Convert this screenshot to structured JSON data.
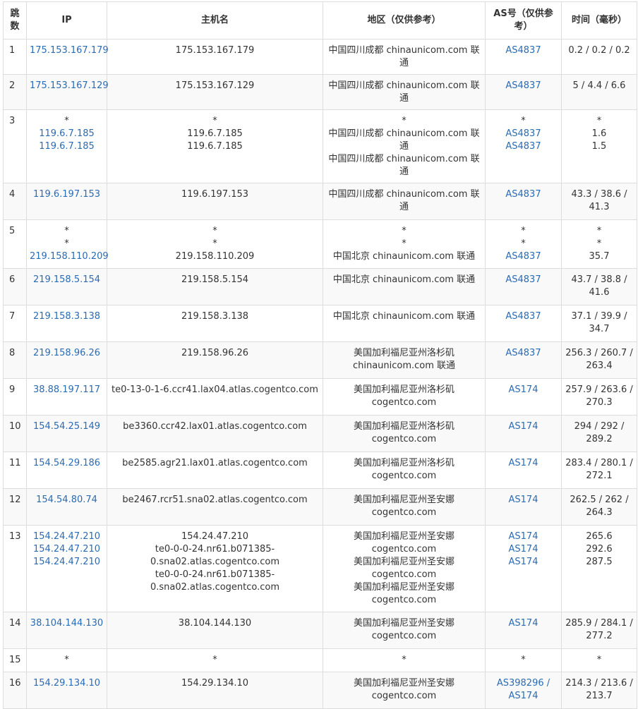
{
  "headers": {
    "hop": "跳数",
    "ip": "IP",
    "hostname": "主机名",
    "region": "地区（仅供参考）",
    "asn": "AS号（仅供参考）",
    "time": "时间（毫秒）"
  },
  "rows": [
    {
      "hop": "1",
      "ip": [
        "175.153.167.179"
      ],
      "host": [
        "175.153.167.179"
      ],
      "region": [
        "中国四川成都 chinaunicom.com 联通"
      ],
      "as": [
        "AS4837"
      ],
      "time": [
        "0.2 / 0.2 / 0.2"
      ]
    },
    {
      "hop": "2",
      "ip": [
        "175.153.167.129"
      ],
      "host": [
        "175.153.167.129"
      ],
      "region": [
        "中国四川成都 chinaunicom.com 联通"
      ],
      "as": [
        "AS4837"
      ],
      "time": [
        "5 / 4.4 / 6.6"
      ]
    },
    {
      "hop": "3",
      "ip": [
        "*",
        "119.6.7.185",
        "119.6.7.185"
      ],
      "host": [
        "*",
        "119.6.7.185",
        "119.6.7.185"
      ],
      "region": [
        "*",
        "中国四川成都 chinaunicom.com 联通",
        "中国四川成都 chinaunicom.com 联通"
      ],
      "as": [
        "*",
        "AS4837",
        "AS4837"
      ],
      "time": [
        "*",
        "1.6",
        "1.5"
      ]
    },
    {
      "hop": "4",
      "ip": [
        "119.6.197.153"
      ],
      "host": [
        "119.6.197.153"
      ],
      "region": [
        "中国四川成都 chinaunicom.com 联通"
      ],
      "as": [
        "AS4837"
      ],
      "time": [
        "43.3 / 38.6 /",
        "41.3"
      ]
    },
    {
      "hop": "5",
      "ip": [
        "*",
        "*",
        "219.158.110.209"
      ],
      "host": [
        "*",
        "*",
        "219.158.110.209"
      ],
      "region": [
        "*",
        "*",
        "中国北京 chinaunicom.com 联通"
      ],
      "as": [
        "*",
        "*",
        "AS4837"
      ],
      "time": [
        "*",
        "*",
        "35.7"
      ]
    },
    {
      "hop": "6",
      "ip": [
        "219.158.5.154"
      ],
      "host": [
        "219.158.5.154"
      ],
      "region": [
        "中国北京 chinaunicom.com 联通"
      ],
      "as": [
        "AS4837"
      ],
      "time": [
        "43.7 / 38.8 /",
        "41.6"
      ]
    },
    {
      "hop": "7",
      "ip": [
        "219.158.3.138"
      ],
      "host": [
        "219.158.3.138"
      ],
      "region": [
        "中国北京 chinaunicom.com 联通"
      ],
      "as": [
        "AS4837"
      ],
      "time": [
        "37.1 / 39.9 /",
        "34.7"
      ]
    },
    {
      "hop": "8",
      "ip": [
        "219.158.96.26"
      ],
      "host": [
        "219.158.96.26"
      ],
      "region": [
        "美国加利福尼亚州洛杉矶",
        "chinaunicom.com 联通"
      ],
      "as": [
        "AS4837"
      ],
      "time": [
        "256.3 / 260.7 /",
        "263.4"
      ]
    },
    {
      "hop": "9",
      "ip": [
        "38.88.197.117"
      ],
      "host": [
        "te0-13-0-1-6.ccr41.lax04.atlas.cogentco.com"
      ],
      "region": [
        "美国加利福尼亚州洛杉矶",
        "cogentco.com"
      ],
      "as": [
        "AS174"
      ],
      "time": [
        "257.9 / 263.6 /",
        "270.3"
      ]
    },
    {
      "hop": "10",
      "ip": [
        "154.54.25.149"
      ],
      "host": [
        "be3360.ccr42.lax01.atlas.cogentco.com"
      ],
      "region": [
        "美国加利福尼亚州洛杉矶",
        "cogentco.com"
      ],
      "as": [
        "AS174"
      ],
      "time": [
        "294 / 292 /",
        "289.2"
      ]
    },
    {
      "hop": "11",
      "ip": [
        "154.54.29.186"
      ],
      "host": [
        "be2585.agr21.lax01.atlas.cogentco.com"
      ],
      "region": [
        "美国加利福尼亚州洛杉矶",
        "cogentco.com"
      ],
      "as": [
        "AS174"
      ],
      "time": [
        "283.4 / 280.1 /",
        "272.1"
      ]
    },
    {
      "hop": "12",
      "ip": [
        "154.54.80.74"
      ],
      "host": [
        "be2467.rcr51.sna02.atlas.cogentco.com"
      ],
      "region": [
        "美国加利福尼亚州圣安娜",
        "cogentco.com"
      ],
      "as": [
        "AS174"
      ],
      "time": [
        "262.5 / 262 /",
        "264.3"
      ]
    },
    {
      "hop": "13",
      "ip": [
        "154.24.47.210",
        "154.24.47.210",
        "154.24.47.210"
      ],
      "host": [
        "154.24.47.210",
        "te0-0-0-24.nr61.b071385-",
        "0.sna02.atlas.cogentco.com",
        "te0-0-0-24.nr61.b071385-",
        "0.sna02.atlas.cogentco.com"
      ],
      "region": [
        "美国加利福尼亚州圣安娜",
        "cogentco.com",
        "美国加利福尼亚州圣安娜",
        "cogentco.com",
        "美国加利福尼亚州圣安娜",
        "cogentco.com"
      ],
      "as": [
        "AS174",
        "AS174",
        "AS174"
      ],
      "time": [
        "265.6",
        "292.6",
        "287.5"
      ]
    },
    {
      "hop": "14",
      "ip": [
        "38.104.144.130"
      ],
      "host": [
        "38.104.144.130"
      ],
      "region": [
        "美国加利福尼亚州圣安娜",
        "cogentco.com"
      ],
      "as": [
        "AS174"
      ],
      "time": [
        "285.9 / 284.1 /",
        "277.2"
      ]
    },
    {
      "hop": "15",
      "ip": [
        "*"
      ],
      "host": [
        "*"
      ],
      "region": [
        "*"
      ],
      "as": [
        "*"
      ],
      "time": [
        "*"
      ]
    },
    {
      "hop": "16",
      "ip": [
        "154.29.134.10"
      ],
      "host": [
        "154.29.134.10"
      ],
      "region": [
        "美国加利福尼亚州圣安娜",
        "cogentco.com"
      ],
      "as": [
        "AS398296 /",
        "AS174"
      ],
      "time": [
        "214.3 / 213.6 /",
        "213.7"
      ]
    }
  ]
}
